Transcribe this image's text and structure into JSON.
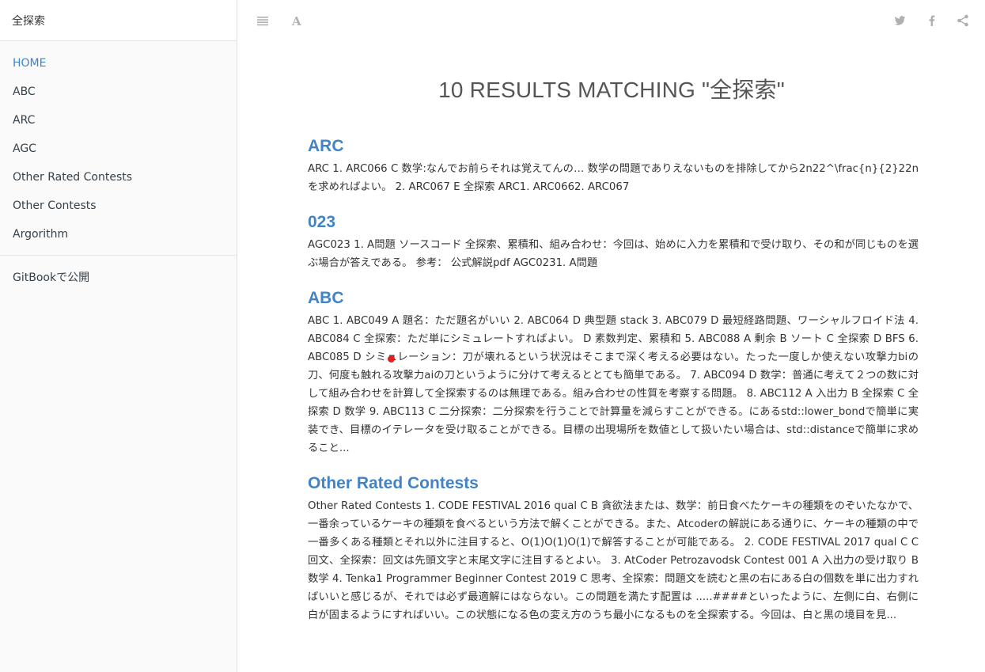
{
  "search": {
    "value": "全探索"
  },
  "sidebar": {
    "items": [
      {
        "label": "HOME",
        "active": true
      },
      {
        "label": "ABC"
      },
      {
        "label": "ARC"
      },
      {
        "label": "AGC"
      },
      {
        "label": "Other Rated Contests"
      },
      {
        "label": "Other Contests"
      },
      {
        "label": "Argorithm"
      }
    ],
    "footer_label": "GitBookで公開"
  },
  "toolbar": {
    "left_icons": [
      "list-icon",
      "font-icon"
    ],
    "right_icons": [
      "twitter-icon",
      "facebook-icon",
      "share-icon"
    ]
  },
  "main": {
    "results_title": "10 RESULTS MATCHING \"全探索\"",
    "results": [
      {
        "title": "ARC",
        "body": "ARC 1. ARC066 C 数学:なんでお前らそれは覚えてんの… 数学の問題でありえないものを排除してから2n22^\\frac{n}{2}22nを求めればよい。 2. ARC067 E 全探索 ARC1. ARC0662. ARC067"
      },
      {
        "title": "023",
        "body": "AGC023 1. A問題 ソースコード 全探索、累積和、組み合わせ：今回は、始めに入力を累積和で受け取り、その和が同じものを選ぶ場合が答えである。 参考： 公式解説pdf AGC0231. A問題"
      },
      {
        "title": "ABC",
        "body": "ABC 1. ABC049 A 題名：ただ題名がいい 2. ABC064 D 典型題 stack 3. ABC079 D 最短経路問題、ワーシャルフロイド法 4. ABC084 C 全探索：ただ単にシミュレートすればよい。 D 素数判定、累積和 5. ABC088 A 剰余 B ソート C 全探索 D BFS 6. ABC085 D シミュレーション：刀が壊れるという状況はそこまで深く考える必要はない。たった一度しか使えない攻撃力biの刀、何度も触れる攻撃力aiの刀というように分けて考えるととても簡単である。 7. ABC094 D 数学：普通に考えて２つの数に対して組み合わせを計算して全探索するのは無理である。組み合わせの性質を考察する問題。 8. ABC112 A 入出力 B 全探索 C 全探索 D 数学 9. ABC113 C 二分探索：二分探索を行うことで計算量を減らすことができる。にあるstd::lower_bondで簡単に実装でき、目標のイテレータを受け取ることができる。目標の出現場所を数値として扱いたい場合は、std::distanceで簡単に求めること..."
      },
      {
        "title": "Other Rated Contests",
        "body": "Other Rated Contests 1. CODE FESTIVAL 2016 qual C B 貪欲法または、数学：前日食べたケーキの種類をのぞいたなかで、一番余っているケーキの種類を食べるという方法で解くことができる。また、Atcoderの解説にある通りに、ケーキの種類の中で一番多くある種類とそれ以外に注目すると、O(1)O(1)O(1)で解答することが可能である。 2. CODE FESTIVAL 2017 qual C C 回文、全探索：回文は先頭文字と末尾文字に注目するとよい。 3. AtCoder Petrozavodsk Contest 001 A 入出力の受け取り B 数学 4. Tenka1 Programmer Beginner Contest 2019 C 思考、全探索：問題文を読むと黒の右にある白の個数を単に出力すればいいと感じるが、それでは必ず最適解にはならない。この問題を満たす配置は .....####といったように、左側に白、右側に白が固まるようにすればいい。この状態になる色の変え方のうち最小になるものを全探索する。今回は、白と黒の境目を見..."
      }
    ]
  },
  "colors": {
    "link": "#4183c4",
    "sidebar_bg": "#fafafa",
    "icon": "#b0b0b0",
    "marker": "#e02020"
  }
}
